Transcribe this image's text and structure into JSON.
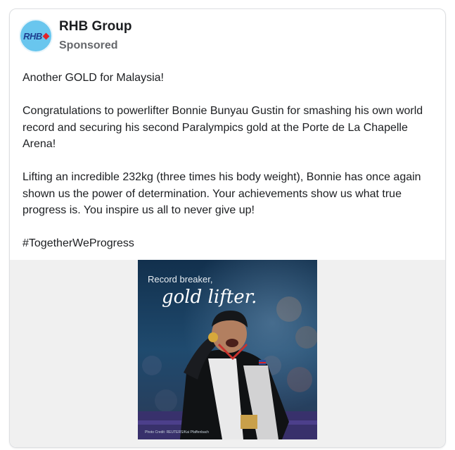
{
  "post": {
    "page_name": "RHB Group",
    "sponsored_label": "Sponsored",
    "avatar_text": "RHB",
    "paragraphs": [
      "Another GOLD for Malaysia!",
      "Congratulations to powerlifter Bonnie Bunyau Gustin for smashing his own world record and securing his second Paralympics gold at the Porte de La Chapelle Arena!",
      "Lifting an incredible 232kg (three times his body weight), Bonnie has once again shown us the power of determination. Your achievements show us what true progress is. You inspire us all to never give up!",
      "#TogetherWeProgress"
    ]
  },
  "image": {
    "headline_line1": "Record breaker,",
    "headline_line2": "gold lifter.",
    "credit": "Photo Credit: REUTERS/Kai Pfaffenbach"
  },
  "colors": {
    "brand_blue": "#1d3d8f",
    "brand_red": "#e2232a",
    "avatar_bg": "#69c6ee"
  }
}
